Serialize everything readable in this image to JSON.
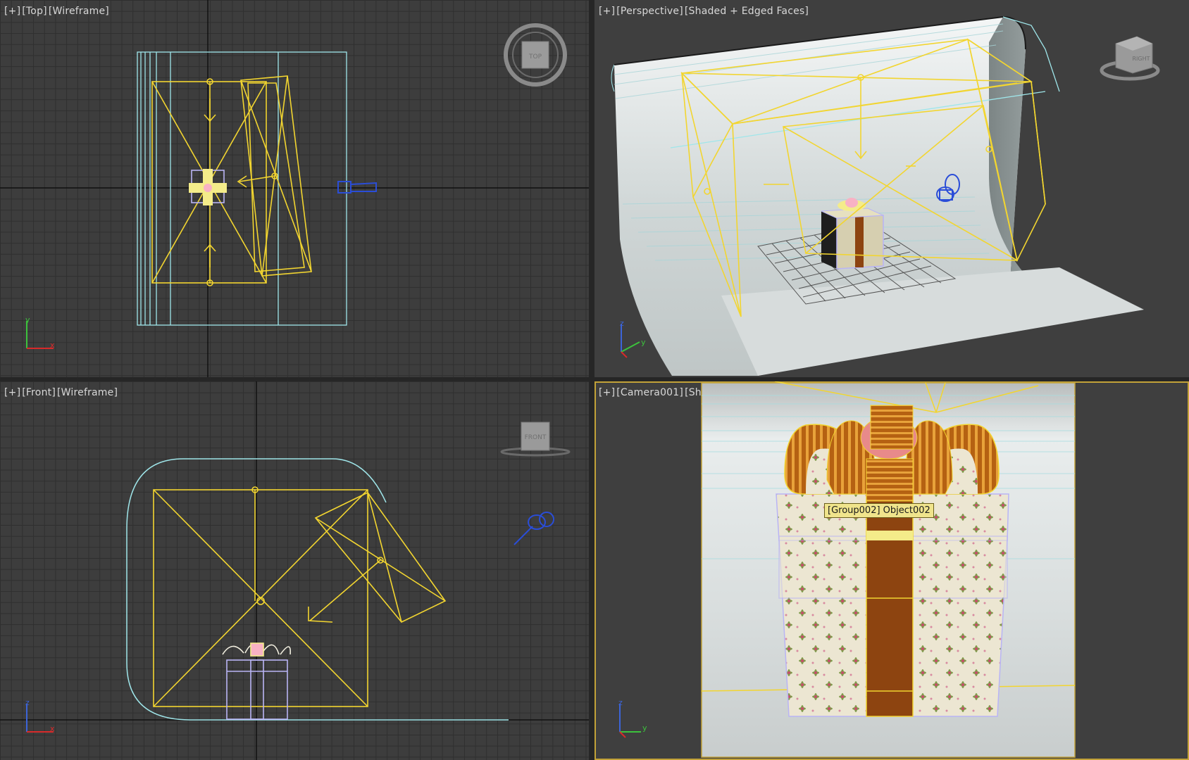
{
  "viewports": {
    "top": {
      "plus": "[+]",
      "name": "[Top]",
      "mode": "[Wireframe]",
      "navcube": "TOP"
    },
    "persp": {
      "plus": "[+]",
      "name": "[Perspective]",
      "mode": "[Shaded + Edged Faces]",
      "navcube": "RIGHT"
    },
    "front": {
      "plus": "[+]",
      "name": "[Front]",
      "mode": "[Wireframe]",
      "navcube": "FRONT"
    },
    "camera": {
      "plus": "[+]",
      "name": "[Camera001]",
      "mode": "[Sh"
    }
  },
  "tooltip": "[Group002] Object002",
  "axes": {
    "x": "x",
    "y": "y",
    "z": "z"
  },
  "colors": {
    "light": "#f2d530",
    "cyclorama": "#9fe6ea",
    "camera": "#2a4dd8",
    "gift_box": "#b9b4f5",
    "ribbon": "#8d4410",
    "active_border": "#c2a238",
    "axis_x": "#d82a2a",
    "axis_y": "#3cc23c",
    "axis_z": "#3c64d8"
  }
}
